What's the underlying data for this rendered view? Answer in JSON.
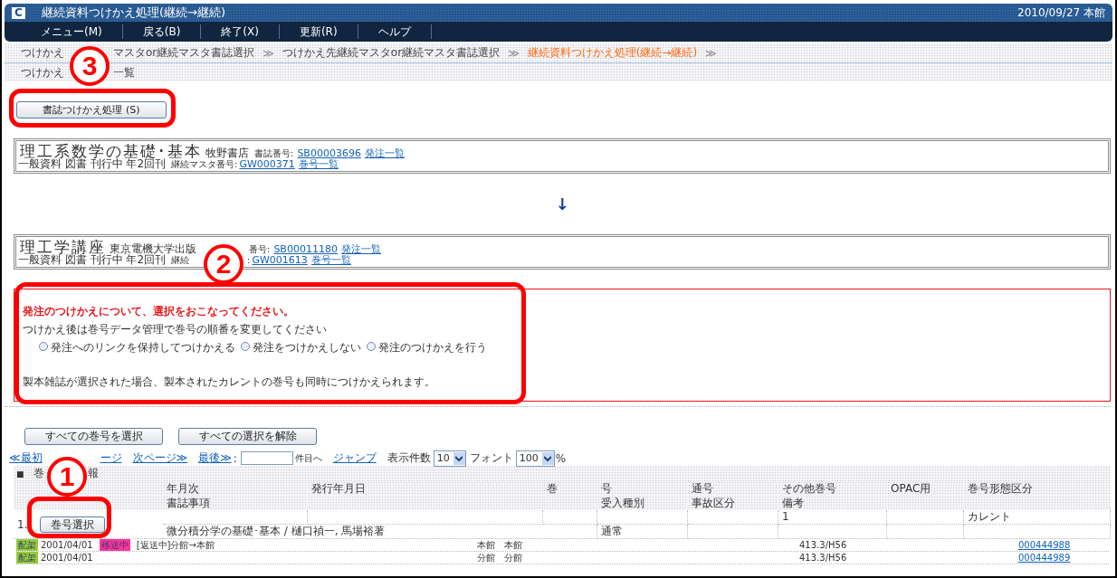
{
  "window": {
    "logo": "C",
    "title": "継続資料つけかえ処理(継続→継続)",
    "date_location": "2010/09/27 本館"
  },
  "menu": [
    {
      "label": "メニュー(M)"
    },
    {
      "label": "戻る(B)"
    },
    {
      "label": "終了(X)"
    },
    {
      "label": "更新(R)"
    },
    {
      "label": "ヘルプ"
    }
  ],
  "breadcrumb": {
    "separator": "≫",
    "rows": [
      [
        {
          "parts": [
            "つけかえ",
            "マスタor継続マスタ書誌選択"
          ],
          "current": false
        },
        {
          "parts": [
            "つけかえ先継続マスタor継続マスタ書誌選択"
          ],
          "current": false
        },
        {
          "parts": [
            "継続資料つけかえ処理(継続→継続)"
          ],
          "current": true
        }
      ],
      [
        {
          "parts": [
            "つけかえ",
            "一覧"
          ],
          "current": false
        }
      ]
    ]
  },
  "process_button": "書誌つけかえ処理 (S)",
  "source": {
    "title": "理工系数学の基礎･基本",
    "publisher": "牧野書店",
    "bib_label": "書誌番号:",
    "bib_no": "SB00003696",
    "order_link": "発注一覧",
    "info": "一般資料 図書 刊行中 年2回刊",
    "master_label": [
      "継続マスタ番号:"
    ],
    "master_no": "GW000371",
    "volume_link": "巻号一覧"
  },
  "arrow": "↓",
  "target": {
    "title": "理工学講座",
    "publisher": "東京電機大学出版",
    "bib_label": "番号:",
    "bib_no": "SB00011180",
    "order_link": "発注一覧",
    "info": "一般資料 図書 刊行中 年2回刊",
    "master_label": [
      "継続",
      ":"
    ],
    "master_no": "GW001613",
    "volume_link": "巻号一覧"
  },
  "notice": {
    "heading": "発注のつけかえについて、選択をおこなってください。",
    "instruction": "つけかえ後は巻号データ管理で巻号の順番を変更してください",
    "options": [
      {
        "label": "発注へのリンクを保持してつけかえる",
        "selected": false
      },
      {
        "label": "発注をつけかえしない",
        "selected": false
      },
      {
        "label": "発注のつけかえを行う",
        "selected": false
      }
    ],
    "note": "製本雑誌が選択された場合、製本されたカレントの巻号も同時につけかえられます。"
  },
  "volume_buttons": [
    "すべての巻号を選択",
    "すべての選択を解除"
  ],
  "pager": {
    "first": "≪最初",
    "prev": "ージ",
    "next": "次ページ≫",
    "last": "最後≫",
    "colon": ":",
    "goto_suffix": "件目へ",
    "jump": "ジャンプ",
    "per_page_label": "表示件数",
    "per_page": "10",
    "font_label": "フォント",
    "font": "100",
    "percent": "%"
  },
  "volume_section": {
    "marker": "■",
    "title_parts": [
      "巻",
      "報"
    ]
  },
  "volume_table": {
    "columns": [
      {
        "heading": "年月次",
        "subheading": "書誌事項"
      },
      {
        "heading": "発行年月日"
      },
      {
        "heading": "巻"
      },
      {
        "heading": "号",
        "subheading": "受入種別"
      },
      {
        "heading": "通号",
        "subheading": "事故区分"
      },
      {
        "heading": "その他巻号",
        "subheading": "備考"
      },
      {
        "heading": "OPAC用"
      },
      {
        "heading": "巻号形態区分"
      }
    ],
    "rows": [
      {
        "number": "1.",
        "button": "巻号選択",
        "cells": [
          null,
          null,
          null,
          null,
          null,
          "1",
          null,
          "カレント"
        ],
        "bibliographic": "微分積分学の基礎･基本 / 樋口禎一, 馬場裕著",
        "sub_cells": [
          "通常",
          null,
          null,
          null,
          null
        ]
      }
    ]
  },
  "holdings": [
    {
      "status": {
        "label": "配架",
        "color": "#99cc33"
      },
      "date": "2001/04/01",
      "transit": {
        "label": "移送中",
        "color": "#ff3399"
      },
      "note": "[返送中]分館→本館",
      "location": "本館　本館",
      "call_no": "413.3/H56",
      "item_no": "000444988"
    },
    {
      "status": {
        "label": "配架",
        "color": "#99cc33"
      },
      "date": "2001/04/01",
      "location": "分館　分館",
      "call_no": "413.3/H56",
      "item_no": "000444989"
    }
  ],
  "annotations": [
    {
      "number": "3"
    },
    {
      "number": "2"
    },
    {
      "number": "1"
    }
  ]
}
